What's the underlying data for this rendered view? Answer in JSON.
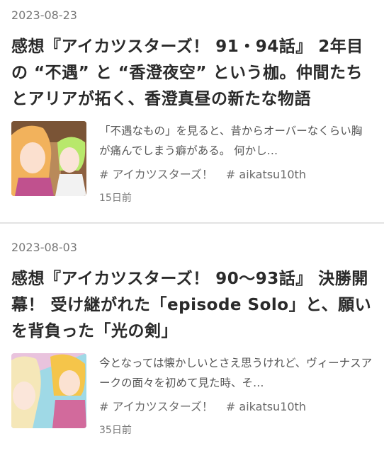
{
  "posts": [
    {
      "date": "2023-08-23",
      "title": "感想『アイカツスターズ！ 91・94話』 2年目の “不遇” と “香澄夜空” という枷。仲間たちとアリアが拓く、香澄真昼の新たな物語",
      "excerpt": "「不遇なもの」を見ると、昔からオーバーなくらい胸が痛んでしまう癖がある。 何かし…",
      "tags": [
        "# アイカツスターズ！",
        "# aikatsu10th"
      ],
      "age": "15日前"
    },
    {
      "date": "2023-08-03",
      "title": "感想『アイカツスターズ！ 90〜93話』 決勝開幕！ 受け継がれた「episode Solo」と、願いを背負った「光の剣」",
      "excerpt": "今となっては懐かしいとさえ思うけれど、ヴィーナスアークの面々を初めて見た時、そ…",
      "tags": [
        "# アイカツスターズ！",
        "# aikatsu10th"
      ],
      "age": "35日前"
    }
  ]
}
